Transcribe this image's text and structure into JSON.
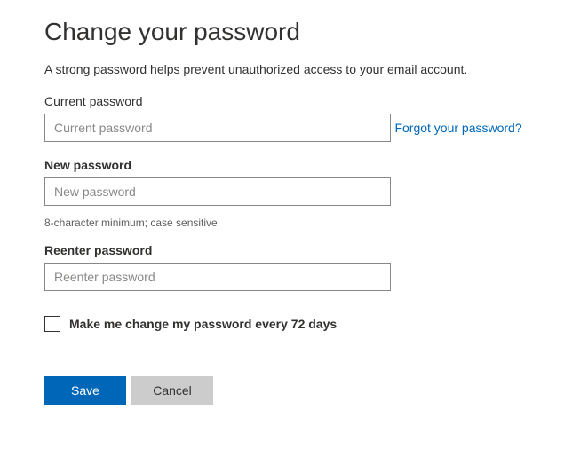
{
  "title": "Change your password",
  "description": "A strong password helps prevent unauthorized access to your email account.",
  "currentPassword": {
    "label": "Current password",
    "placeholder": "Current password",
    "value": ""
  },
  "forgotLink": "Forgot your password?",
  "newPassword": {
    "label": "New password",
    "placeholder": "New password",
    "value": ""
  },
  "hint": "8-character minimum; case sensitive",
  "reenterPassword": {
    "label": "Reenter password",
    "placeholder": "Reenter password",
    "value": ""
  },
  "checkbox": {
    "label": "Make me change my password every 72 days",
    "checked": false
  },
  "buttons": {
    "save": "Save",
    "cancel": "Cancel"
  }
}
